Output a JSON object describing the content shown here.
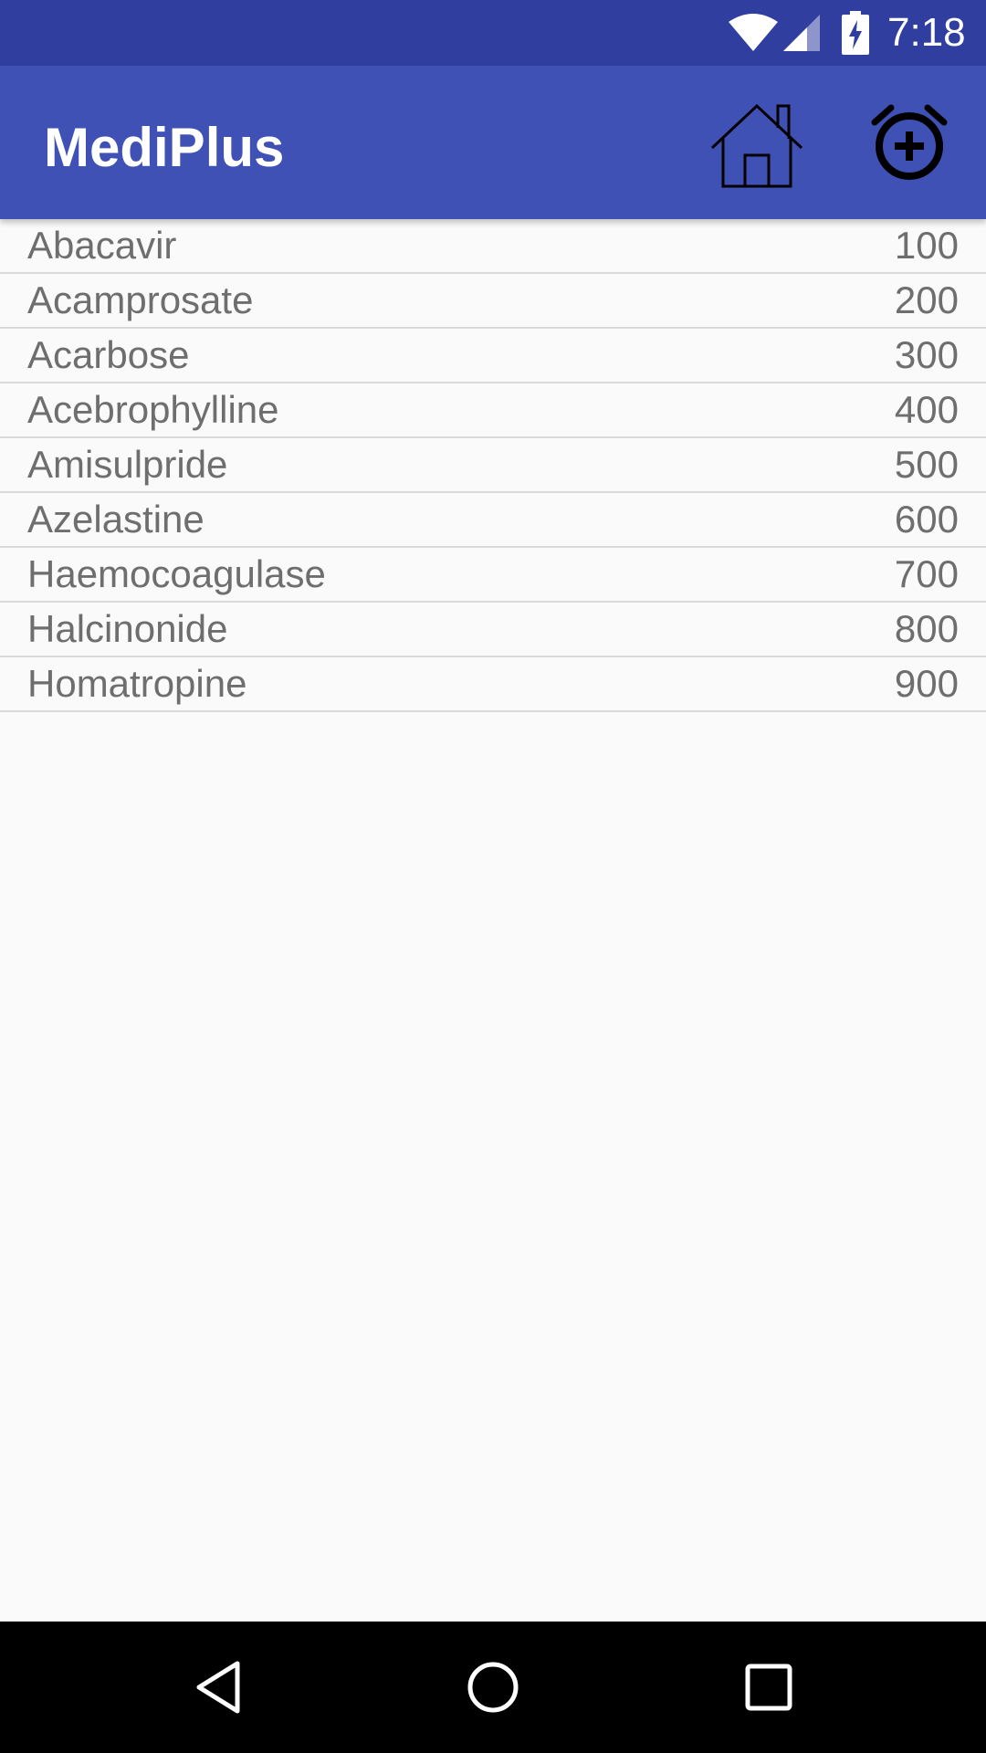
{
  "status_bar": {
    "time": "7:18",
    "icons": [
      "wifi-icon",
      "cell-signal-icon",
      "battery-charging-icon"
    ]
  },
  "app_bar": {
    "title": "MediPlus",
    "actions": [
      {
        "name": "home-button",
        "icon": "home-icon"
      },
      {
        "name": "add-alarm-button",
        "icon": "alarm-add-icon"
      }
    ]
  },
  "medicines": [
    {
      "name": "Abacavir",
      "value": "100"
    },
    {
      "name": "Acamprosate",
      "value": "200"
    },
    {
      "name": "Acarbose",
      "value": "300"
    },
    {
      "name": "Acebrophylline",
      "value": "400"
    },
    {
      "name": "Amisulpride",
      "value": "500"
    },
    {
      "name": "Azelastine",
      "value": "600"
    },
    {
      "name": "Haemocoagulase",
      "value": "700"
    },
    {
      "name": "Halcinonide",
      "value": "800"
    },
    {
      "name": "Homatropine",
      "value": "900"
    }
  ],
  "nav_bar": {
    "icons": [
      "back-icon",
      "home-circle-icon",
      "recents-icon"
    ]
  },
  "colors": {
    "status_bar": "#303f9f",
    "app_bar": "#3f51b5",
    "background": "#fafafa",
    "row_text": "#6e6e6e",
    "divider": "#dadada"
  }
}
